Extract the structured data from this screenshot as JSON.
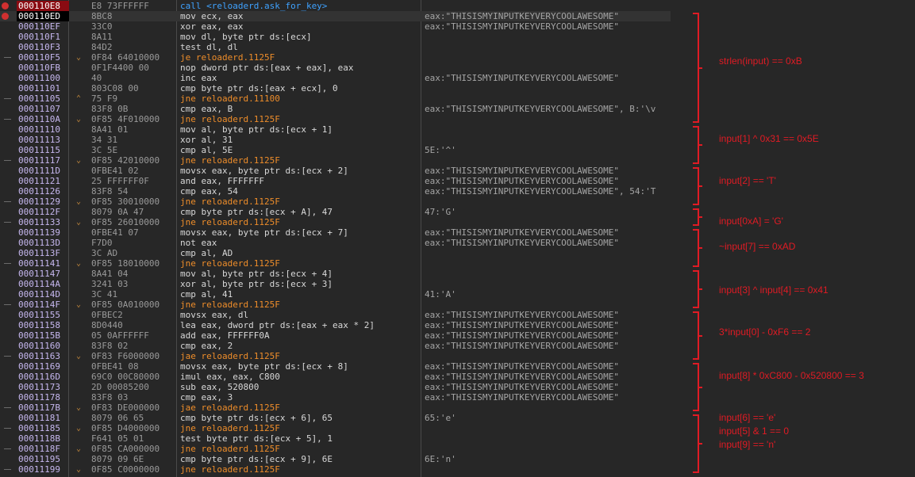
{
  "rows": [
    {
      "addr": "000110E8",
      "bytes": "E8 73FFFFFF",
      "instr": "call <reloaderd.ask_for_key>",
      "comment": "",
      "kind": "call",
      "mark": "bp",
      "state": "eip",
      "arrow": ""
    },
    {
      "addr": "000110ED",
      "bytes": "8BC8",
      "instr": "mov ecx, eax",
      "comment": "eax:\"THISISMYINPUTKEYVERYCOOLAWESOME\"",
      "kind": "normal",
      "mark": "bp",
      "state": "sel",
      "arrow": ""
    },
    {
      "addr": "000110EF",
      "bytes": "33C0",
      "instr": "xor eax, eax",
      "comment": "eax:\"THISISMYINPUTKEYVERYCOOLAWESOME\"",
      "kind": "normal",
      "mark": "",
      "state": "",
      "arrow": ""
    },
    {
      "addr": "000110F1",
      "bytes": "8A11",
      "instr": "mov dl, byte ptr ds:[ecx]",
      "comment": "",
      "kind": "normal",
      "mark": "",
      "state": "",
      "arrow": ""
    },
    {
      "addr": "000110F3",
      "bytes": "84D2",
      "instr": "test dl, dl",
      "comment": "",
      "kind": "normal",
      "mark": "",
      "state": "",
      "arrow": ""
    },
    {
      "addr": "000110F5",
      "bytes": "0F84 64010000",
      "instr": "je reloaderd.1125F",
      "comment": "",
      "kind": "jump",
      "mark": "j",
      "state": "",
      "arrow": "⌄"
    },
    {
      "addr": "000110FB",
      "bytes": "0F1F4400 00",
      "instr": "nop dword ptr ds:[eax + eax], eax",
      "comment": "",
      "kind": "normal",
      "mark": "",
      "state": "",
      "arrow": ""
    },
    {
      "addr": "00011100",
      "bytes": "40",
      "instr": "inc eax",
      "comment": "eax:\"THISISMYINPUTKEYVERYCOOLAWESOME\"",
      "kind": "normal",
      "mark": "",
      "state": "",
      "arrow": ""
    },
    {
      "addr": "00011101",
      "bytes": "803C08 00",
      "instr": "cmp byte ptr ds:[eax + ecx], 0",
      "comment": "",
      "kind": "normal",
      "mark": "",
      "state": "",
      "arrow": ""
    },
    {
      "addr": "00011105",
      "bytes": "75 F9",
      "instr": "jne reloaderd.11100",
      "comment": "",
      "kind": "jump",
      "mark": "j",
      "state": "",
      "arrow": "⌃"
    },
    {
      "addr": "00011107",
      "bytes": "83F8 0B",
      "instr": "cmp eax, B",
      "comment": "eax:\"THISISMYINPUTKEYVERYCOOLAWESOME\", B:'\\v",
      "kind": "normal",
      "mark": "",
      "state": "",
      "arrow": ""
    },
    {
      "addr": "0001110A",
      "bytes": "0F85 4F010000",
      "instr": "jne reloaderd.1125F",
      "comment": "",
      "kind": "jump",
      "mark": "j",
      "state": "",
      "arrow": "⌄"
    },
    {
      "addr": "00011110",
      "bytes": "8A41 01",
      "instr": "mov al, byte ptr ds:[ecx + 1]",
      "comment": "",
      "kind": "normal",
      "mark": "",
      "state": "",
      "arrow": ""
    },
    {
      "addr": "00011113",
      "bytes": "34 31",
      "instr": "xor al, 31",
      "comment": "",
      "kind": "normal",
      "mark": "",
      "state": "",
      "arrow": ""
    },
    {
      "addr": "00011115",
      "bytes": "3C 5E",
      "instr": "cmp al, 5E",
      "comment": "5E:'^'",
      "kind": "normal",
      "mark": "",
      "state": "",
      "arrow": ""
    },
    {
      "addr": "00011117",
      "bytes": "0F85 42010000",
      "instr": "jne reloaderd.1125F",
      "comment": "",
      "kind": "jump",
      "mark": "j",
      "state": "",
      "arrow": "⌄"
    },
    {
      "addr": "0001111D",
      "bytes": "0FBE41 02",
      "instr": "movsx eax, byte ptr ds:[ecx + 2]",
      "comment": "eax:\"THISISMYINPUTKEYVERYCOOLAWESOME\"",
      "kind": "normal",
      "mark": "",
      "state": "",
      "arrow": ""
    },
    {
      "addr": "00011121",
      "bytes": "25 FFFFFF0F",
      "instr": "and eax, FFFFFFF",
      "comment": "eax:\"THISISMYINPUTKEYVERYCOOLAWESOME\"",
      "kind": "normal",
      "mark": "",
      "state": "",
      "arrow": ""
    },
    {
      "addr": "00011126",
      "bytes": "83F8 54",
      "instr": "cmp eax, 54",
      "comment": "eax:\"THISISMYINPUTKEYVERYCOOLAWESOME\", 54:'T",
      "kind": "normal",
      "mark": "",
      "state": "",
      "arrow": ""
    },
    {
      "addr": "00011129",
      "bytes": "0F85 30010000",
      "instr": "jne reloaderd.1125F",
      "comment": "",
      "kind": "jump",
      "mark": "j",
      "state": "",
      "arrow": "⌄"
    },
    {
      "addr": "0001112F",
      "bytes": "8079 0A 47",
      "instr": "cmp byte ptr ds:[ecx + A], 47",
      "comment": "47:'G'",
      "kind": "normal",
      "mark": "",
      "state": "",
      "arrow": ""
    },
    {
      "addr": "00011133",
      "bytes": "0F85 26010000",
      "instr": "jne reloaderd.1125F",
      "comment": "",
      "kind": "jump",
      "mark": "j",
      "state": "",
      "arrow": "⌄"
    },
    {
      "addr": "00011139",
      "bytes": "0FBE41 07",
      "instr": "movsx eax, byte ptr ds:[ecx + 7]",
      "comment": "eax:\"THISISMYINPUTKEYVERYCOOLAWESOME\"",
      "kind": "normal",
      "mark": "",
      "state": "",
      "arrow": ""
    },
    {
      "addr": "0001113D",
      "bytes": "F7D0",
      "instr": "not eax",
      "comment": "eax:\"THISISMYINPUTKEYVERYCOOLAWESOME\"",
      "kind": "normal",
      "mark": "",
      "state": "",
      "arrow": ""
    },
    {
      "addr": "0001113F",
      "bytes": "3C AD",
      "instr": "cmp al, AD",
      "comment": "",
      "kind": "normal",
      "mark": "",
      "state": "",
      "arrow": ""
    },
    {
      "addr": "00011141",
      "bytes": "0F85 18010000",
      "instr": "jne reloaderd.1125F",
      "comment": "",
      "kind": "jump",
      "mark": "j",
      "state": "",
      "arrow": "⌄"
    },
    {
      "addr": "00011147",
      "bytes": "8A41 04",
      "instr": "mov al, byte ptr ds:[ecx + 4]",
      "comment": "",
      "kind": "normal",
      "mark": "",
      "state": "",
      "arrow": ""
    },
    {
      "addr": "0001114A",
      "bytes": "3241 03",
      "instr": "xor al, byte ptr ds:[ecx + 3]",
      "comment": "",
      "kind": "normal",
      "mark": "",
      "state": "",
      "arrow": ""
    },
    {
      "addr": "0001114D",
      "bytes": "3C 41",
      "instr": "cmp al, 41",
      "comment": "41:'A'",
      "kind": "normal",
      "mark": "",
      "state": "",
      "arrow": ""
    },
    {
      "addr": "0001114F",
      "bytes": "0F85 0A010000",
      "instr": "jne reloaderd.1125F",
      "comment": "",
      "kind": "jump",
      "mark": "j",
      "state": "",
      "arrow": "⌄"
    },
    {
      "addr": "00011155",
      "bytes": "0FBEC2",
      "instr": "movsx eax, dl",
      "comment": "eax:\"THISISMYINPUTKEYVERYCOOLAWESOME\"",
      "kind": "normal",
      "mark": "",
      "state": "",
      "arrow": ""
    },
    {
      "addr": "00011158",
      "bytes": "8D0440",
      "instr": "lea eax, dword ptr ds:[eax + eax * 2]",
      "comment": "eax:\"THISISMYINPUTKEYVERYCOOLAWESOME\"",
      "kind": "normal",
      "mark": "",
      "state": "",
      "arrow": ""
    },
    {
      "addr": "0001115B",
      "bytes": "05 0AFFFFFF",
      "instr": "add eax, FFFFFF0A",
      "comment": "eax:\"THISISMYINPUTKEYVERYCOOLAWESOME\"",
      "kind": "normal",
      "mark": "",
      "state": "",
      "arrow": ""
    },
    {
      "addr": "00011160",
      "bytes": "83F8 02",
      "instr": "cmp eax, 2",
      "comment": "eax:\"THISISMYINPUTKEYVERYCOOLAWESOME\"",
      "kind": "normal",
      "mark": "",
      "state": "",
      "arrow": ""
    },
    {
      "addr": "00011163",
      "bytes": "0F83 F6000000",
      "instr": "jae reloaderd.1125F",
      "comment": "",
      "kind": "jump",
      "mark": "j",
      "state": "",
      "arrow": "⌄"
    },
    {
      "addr": "00011169",
      "bytes": "0FBE41 08",
      "instr": "movsx eax, byte ptr ds:[ecx + 8]",
      "comment": "eax:\"THISISMYINPUTKEYVERYCOOLAWESOME\"",
      "kind": "normal",
      "mark": "",
      "state": "",
      "arrow": ""
    },
    {
      "addr": "0001116D",
      "bytes": "69C0 00C80000",
      "instr": "imul eax, eax, C800",
      "comment": "eax:\"THISISMYINPUTKEYVERYCOOLAWESOME\"",
      "kind": "normal",
      "mark": "",
      "state": "",
      "arrow": ""
    },
    {
      "addr": "00011173",
      "bytes": "2D 00085200",
      "instr": "sub eax, 520800",
      "comment": "eax:\"THISISMYINPUTKEYVERYCOOLAWESOME\"",
      "kind": "normal",
      "mark": "",
      "state": "",
      "arrow": ""
    },
    {
      "addr": "00011178",
      "bytes": "83F8 03",
      "instr": "cmp eax, 3",
      "comment": "eax:\"THISISMYINPUTKEYVERYCOOLAWESOME\"",
      "kind": "normal",
      "mark": "",
      "state": "",
      "arrow": ""
    },
    {
      "addr": "0001117B",
      "bytes": "0F83 DE000000",
      "instr": "jae reloaderd.1125F",
      "comment": "",
      "kind": "jump",
      "mark": "j",
      "state": "",
      "arrow": "⌄"
    },
    {
      "addr": "00011181",
      "bytes": "8079 06 65",
      "instr": "cmp byte ptr ds:[ecx + 6], 65",
      "comment": "65:'e'",
      "kind": "normal",
      "mark": "",
      "state": "",
      "arrow": ""
    },
    {
      "addr": "00011185",
      "bytes": "0F85 D4000000",
      "instr": "jne reloaderd.1125F",
      "comment": "",
      "kind": "jump",
      "mark": "j",
      "state": "",
      "arrow": "⌄"
    },
    {
      "addr": "0001118B",
      "bytes": "F641 05 01",
      "instr": "test byte ptr ds:[ecx + 5], 1",
      "comment": "",
      "kind": "normal",
      "mark": "",
      "state": "",
      "arrow": ""
    },
    {
      "addr": "0001118F",
      "bytes": "0F85 CA000000",
      "instr": "jne reloaderd.1125F",
      "comment": "",
      "kind": "jump",
      "mark": "j",
      "state": "",
      "arrow": "⌄"
    },
    {
      "addr": "00011195",
      "bytes": "8079 09 6E",
      "instr": "cmp byte ptr ds:[ecx + 9], 6E",
      "comment": "6E:'n'",
      "kind": "normal",
      "mark": "",
      "state": "",
      "arrow": ""
    },
    {
      "addr": "00011199",
      "bytes": "0F85 C0000000",
      "instr": "jne reloaderd.1125F",
      "comment": "",
      "kind": "jump",
      "mark": "j",
      "state": "",
      "arrow": "⌄"
    }
  ],
  "annotations": [
    {
      "text": "strlen(input) == 0xB",
      "rows": [
        1,
        11
      ],
      "label_row": 5
    },
    {
      "text": "input[1] ^ 0x31 == 0x5E",
      "rows": [
        12,
        15
      ],
      "label_row": 12.5
    },
    {
      "text": "input[2] == 'T'",
      "rows": [
        16,
        19
      ],
      "label_row": 16.6
    },
    {
      "text": "input[0xA] = 'G'",
      "rows": [
        20,
        21
      ],
      "label_row": 20.5
    },
    {
      "text": "~input[7] == 0xAD",
      "rows": [
        22,
        25
      ],
      "label_row": 23
    },
    {
      "text": "input[3] ^ input[4] == 0x41",
      "rows": [
        26,
        29
      ],
      "label_row": 27.2
    },
    {
      "text": "3*input[0] - 0xF6 == 2",
      "rows": [
        30,
        34
      ],
      "label_row": 31.3
    },
    {
      "text": "input[8] * 0xC800 - 0x520800 == 3",
      "rows": [
        35,
        39
      ],
      "label_row": 35.5
    },
    {
      "text": "input[6] == 'e'",
      "rows": null,
      "label_row": 39.6
    },
    {
      "text": "input[5] & 1 == 0",
      "rows": null,
      "label_row": 40.9
    },
    {
      "text": "input[9] == 'n'",
      "rows": null,
      "label_row": 42.2
    }
  ],
  "annotation_bracket_last": {
    "rows": [
      40,
      45
    ]
  },
  "colors": {
    "background": "#272727",
    "annotation": "#e01b24",
    "jump": "#ee8d2a",
    "call": "#3fa2ff"
  }
}
